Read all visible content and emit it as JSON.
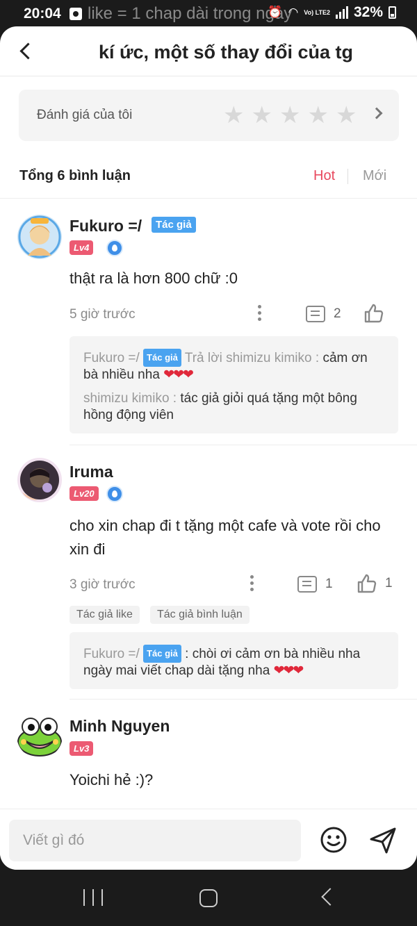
{
  "status_bar": {
    "time": "20:04",
    "notification_preview": "like = 1 chap dài trong ngày",
    "battery": "32%",
    "network_label": "Vo) LTE2"
  },
  "header": {
    "title": "kí ức, một số thay đổi của tg"
  },
  "rating": {
    "label": "Đánh giá của tôi",
    "stars_filled": 0,
    "stars_total": 5
  },
  "comments_header": {
    "count_label": "Tổng 6 bình luận",
    "sort_hot": "Hot",
    "sort_new": "Mới"
  },
  "comments": [
    {
      "username": "Fukuro =/",
      "author_tag": "Tác giả",
      "level": "Lv4",
      "text": "thật ra là hơn 800 chữ :0",
      "time": "5 giờ trước",
      "reply_count": "2",
      "like_count": "",
      "replies": [
        {
          "name": "Fukuro =/",
          "tag": "Tác giả",
          "meta": "Trả lời shimizu kimiko :",
          "text": "cảm ơn bà nhiều nha",
          "hearts": "❤❤❤"
        },
        {
          "name": "shimizu kimiko :",
          "tag": "",
          "meta": "",
          "text": "tác giả giỏi quá tặng một bông hồng động viên",
          "hearts": ""
        }
      ]
    },
    {
      "username": "Iruma",
      "level": "Lv20",
      "text": "cho xin chap đi t tặng một cafe và vote rồi cho xin đi",
      "time": "3 giờ trước",
      "reply_count": "1",
      "like_count": "1",
      "chips": [
        "Tác giả like",
        "Tác giả bình luận"
      ],
      "replies": [
        {
          "name": "Fukuro =/",
          "tag": "Tác giả",
          "meta": "",
          "text": ": chòi ơi cảm ơn bà nhiều nha ngày mai viết chap dài tặng nha",
          "hearts": "❤❤❤"
        }
      ]
    },
    {
      "username": "Minh Nguyen",
      "level": "Lv3",
      "text": "Yoichi hẻ :)?"
    }
  ],
  "input": {
    "placeholder": "Viết gì đó"
  },
  "colors": {
    "accent": "#e8495e",
    "author_tag": "#4aa3f0",
    "level_badge": "#ec5a72",
    "heart": "#e0283a"
  }
}
